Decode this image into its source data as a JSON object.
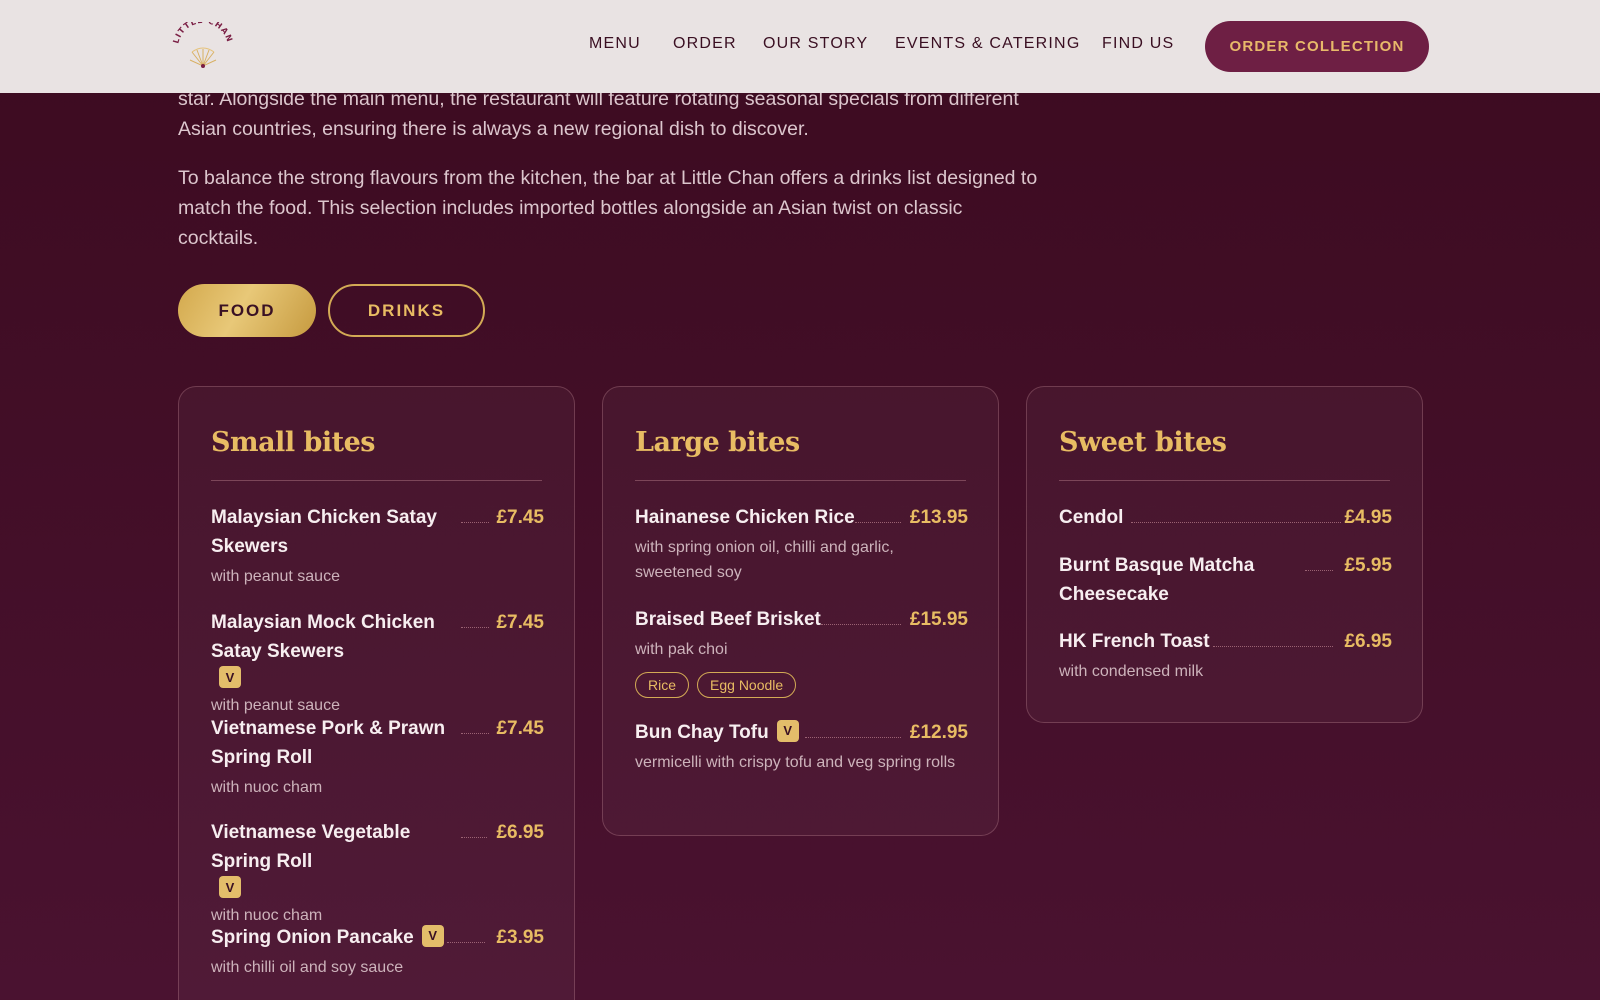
{
  "header": {
    "logo_text": "LITTLE CHAN",
    "nav": [
      "MENU",
      "ORDER",
      "OUR STORY",
      "EVENTS & CATERING",
      "FIND US"
    ],
    "cta": "ORDER COLLECTION"
  },
  "intro": {
    "p1": "star. Alongside the main menu, the restaurant will feature rotating seasonal specials from different Asian countries, ensuring there is always a new regional dish to discover.",
    "p2": "To balance the strong flavours from the kitchen, the bar at Little Chan offers a drinks list designed to match the food. This selection includes imported bottles alongside an Asian twist on classic cocktails."
  },
  "toggles": {
    "food": "FOOD",
    "drinks": "DRINKS"
  },
  "vegetarian_badge": "V",
  "cards": {
    "small": {
      "title": "Small bites",
      "items": [
        {
          "name": "Malaysian Chicken Satay Skewers",
          "price": "£7.45",
          "desc": "with peanut sauce"
        },
        {
          "name": "Malaysian Mock Chicken Satay Skewers",
          "price": "£7.45",
          "desc": "with peanut sauce",
          "vegetarian": true
        },
        {
          "name": "Vietnamese Pork & Prawn Spring Roll",
          "price": "£7.45",
          "desc": "with nuoc cham"
        },
        {
          "name": "Vietnamese Vegetable Spring Roll",
          "price": "£6.95",
          "desc": "with nuoc cham",
          "vegetarian": true
        },
        {
          "name": "Spring Onion Pancake",
          "price": "£3.95",
          "desc": "with chilli oil and soy sauce",
          "vegetarian": true
        }
      ]
    },
    "large": {
      "title": "Large bites",
      "items": [
        {
          "name": "Hainanese Chicken Rice",
          "price": "£13.95",
          "desc": "with spring onion oil, chilli and garlic, sweetened soy"
        },
        {
          "name": "Braised Beef Brisket",
          "price": "£15.95",
          "desc": "with pak choi",
          "tags": [
            "Rice",
            "Egg Noodle"
          ]
        },
        {
          "name": "Bun Chay Tofu",
          "price": "£12.95",
          "desc": "vermicelli with crispy tofu and veg spring rolls",
          "vegetarian": true
        }
      ]
    },
    "sweet": {
      "title": "Sweet bites",
      "items": [
        {
          "name": "Cendol",
          "price": "£4.95",
          "desc": ""
        },
        {
          "name": "Burnt Basque Matcha Cheesecake",
          "price": "£5.95",
          "desc": ""
        },
        {
          "name": "HK French Toast",
          "price": "£6.95",
          "desc": "with condensed milk"
        }
      ]
    }
  },
  "colors": {
    "background": "#3c0b20",
    "header_bg": "#e9e3e3",
    "accent_gold": "#e8bc63",
    "cta_bg": "#6e1f44"
  }
}
